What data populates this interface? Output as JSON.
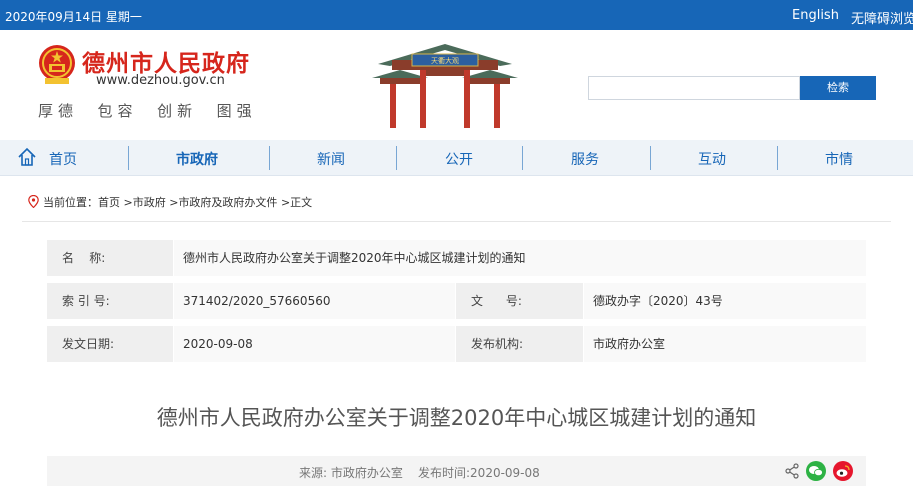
{
  "topbar": {
    "date": "2020年09月14日 星期一",
    "language": "English",
    "accessibility": "无障碍浏览"
  },
  "header": {
    "site_name": "德州市人民政府",
    "site_url": "www.dezhou.gov.cn",
    "motto": "厚德  包容  创新  图强",
    "gate_sign": "天衢大观",
    "search_button": "检索",
    "search_placeholder": ""
  },
  "nav": {
    "items": [
      {
        "label": "首页"
      },
      {
        "label": "市政府"
      },
      {
        "label": "新闻"
      },
      {
        "label": "公开"
      },
      {
        "label": "服务"
      },
      {
        "label": "互动"
      },
      {
        "label": "市情"
      }
    ],
    "active_index": 1
  },
  "breadcrumb": {
    "prefix": "当前位置：",
    "items": [
      "首页",
      "市政府",
      "市政府及政府办文件",
      "正文"
    ],
    "separator": ">"
  },
  "meta": {
    "name_label": "名    称:",
    "name_value": "德州市人民政府办公室关于调整2020年中心城区城建计划的通知",
    "index_label": "索 引 号:",
    "index_value": "371402/2020_57660560",
    "doc_label": "文      号:",
    "doc_value": "德政办字〔2020〕43号",
    "date_label": "发文日期:",
    "date_value": "2020-09-08",
    "org_label": "发布机构:",
    "org_value": "市政府办公室"
  },
  "article": {
    "title": "德州市人民政府办公室关于调整2020年中心城区城建计划的通知",
    "source": "来源: 市政府办公室",
    "publish_time": "发布时间:2020-09-08"
  },
  "colors": {
    "brand_blue": "#1766b7",
    "brand_red": "#d6261c"
  }
}
